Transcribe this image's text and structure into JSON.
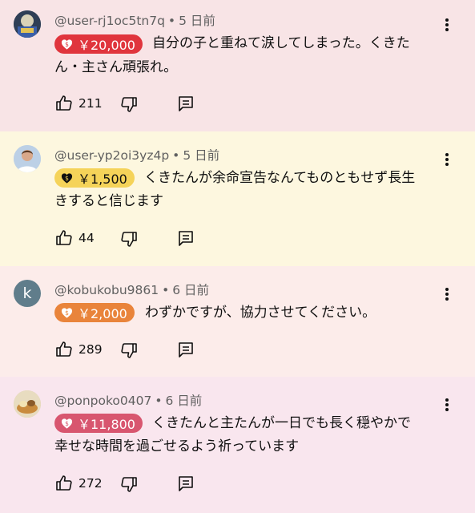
{
  "colors": {
    "bg_red": "#f8e4e6",
    "bg_yellow": "#fdf7df",
    "bg_orange": "#fcecea",
    "bg_pink": "#f9e6ee",
    "chip_red": "#e0353d",
    "chip_yellow": "#f5d359",
    "chip_orange": "#e9843b",
    "chip_pink": "#d8566f"
  },
  "comments": [
    {
      "author": "@user-rj1oc5tn7q",
      "time": "5 日前",
      "amount": "￥20,000",
      "line1": "自分の子と重ねて涙してしまった。くきた",
      "line2": "ん・主さん頑張れ。",
      "likes": "211",
      "avatar": "landscape-photo-avatar"
    },
    {
      "author": "@user-yp2oi3yz4p",
      "time": "5 日前",
      "amount": "￥1,500",
      "line1": "くきたんが余命宣告なんてものともせず長生",
      "line2": "きすると信じます",
      "likes": "44",
      "avatar": "person-photo-avatar"
    },
    {
      "author": "@kobukobu9861",
      "time": "6 日前",
      "amount": "￥2,000",
      "line1": "わずかですが、協力させてください。",
      "likes": "289",
      "avatar_letter": "k"
    },
    {
      "author": "@ponpoko0407",
      "time": "6 日前",
      "amount": "￥11,800",
      "line1": "くきたんと主たんが一日でも長く穏やかで",
      "line2": "幸せな時間を過ごせるよう祈っています",
      "likes": "272",
      "avatar": "food-photo-avatar"
    }
  ],
  "meta_separator": "•",
  "icons": {
    "like": "thumbs-up-icon",
    "dislike": "thumbs-down-icon",
    "reply": "reply-icon",
    "menu": "more-vert-icon",
    "heart": "heart-dollar-icon"
  }
}
